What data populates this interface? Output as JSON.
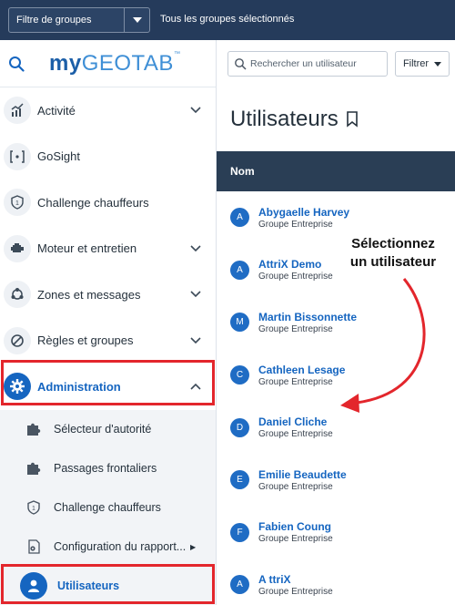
{
  "topbar": {
    "group_filter_label": "Filtre de groupes",
    "status": "Tous les groupes sélectionnés"
  },
  "brand": {
    "logo_my": "my",
    "logo_geotab": "GEOTAB",
    "logo_tm": "™"
  },
  "sidebar": {
    "items": [
      {
        "label": "Activité",
        "icon": "chart-icon",
        "expandable": true
      },
      {
        "label": "GoSight",
        "icon": "gosight-icon",
        "expandable": false
      },
      {
        "label": "Challenge chauffeurs",
        "icon": "shield-icon",
        "expandable": false
      },
      {
        "label": "Moteur et entretien",
        "icon": "engine-icon",
        "expandable": true
      },
      {
        "label": "Zones et messages",
        "icon": "zones-icon",
        "expandable": true
      },
      {
        "label": "Règles et groupes",
        "icon": "rules-icon",
        "expandable": true
      },
      {
        "label": "Administration",
        "icon": "gear-icon",
        "expandable": true,
        "expanded": true
      }
    ],
    "subitems": [
      {
        "label": "Sélecteur d'autorité",
        "icon": "puzzle-icon"
      },
      {
        "label": "Passages frontaliers",
        "icon": "puzzle-icon"
      },
      {
        "label": "Challenge chauffeurs",
        "icon": "shield-icon"
      },
      {
        "label": "Configuration du rapport...",
        "icon": "report-config-icon",
        "has_submenu": true
      },
      {
        "label": "Utilisateurs",
        "icon": "user-icon",
        "selected": true
      }
    ]
  },
  "main": {
    "search_placeholder": "Rechercher un utilisateur",
    "filter_label": "Filtrer",
    "page_title": "Utilisateurs",
    "column_name": "Nom",
    "users": [
      {
        "initial": "A",
        "name": "Abygaelle Harvey",
        "group": "Groupe Entreprise"
      },
      {
        "initial": "A",
        "name": "AttriX Demo",
        "group": "Groupe Entreprise"
      },
      {
        "initial": "M",
        "name": "Martin Bissonnette",
        "group": "Groupe Entreprise"
      },
      {
        "initial": "C",
        "name": "Cathleen Lesage",
        "group": "Groupe Entreprise"
      },
      {
        "initial": "D",
        "name": "Daniel Cliche",
        "group": "Groupe Entreprise"
      },
      {
        "initial": "E",
        "name": "Emilie Beaudette",
        "group": "Groupe Entreprise"
      },
      {
        "initial": "F",
        "name": "Fabien Coung",
        "group": "Groupe Entreprise"
      },
      {
        "initial": "A",
        "name": "A ttriX",
        "group": "Groupe Entreprise"
      }
    ]
  },
  "annotation": {
    "line1": "Sélectionnez",
    "line2": "un utilisateur"
  },
  "colors": {
    "accent": "#1565c0",
    "topbar": "#253b5b",
    "table_header": "#2a3e55",
    "highlight_red": "#e3262c"
  }
}
